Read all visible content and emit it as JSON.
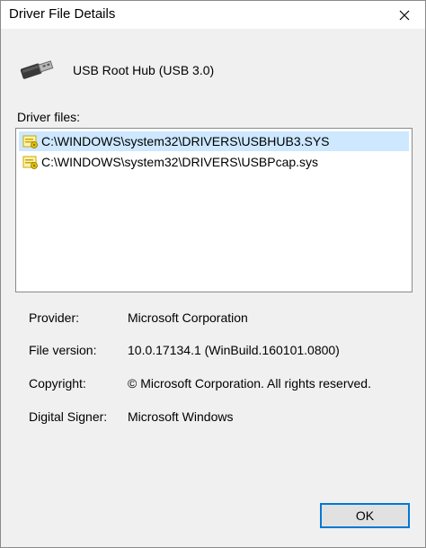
{
  "window": {
    "title": "Driver File Details",
    "close_icon": "close-icon"
  },
  "device": {
    "icon": "usb-plug-icon",
    "name": "USB Root Hub (USB 3.0)"
  },
  "driver_files": {
    "label": "Driver files:",
    "items": [
      {
        "path": "C:\\WINDOWS\\system32\\DRIVERS\\USBHUB3.SYS",
        "selected": true
      },
      {
        "path": "C:\\WINDOWS\\system32\\DRIVERS\\USBPcap.sys",
        "selected": false
      }
    ]
  },
  "details": {
    "provider_label": "Provider:",
    "provider_value": "Microsoft Corporation",
    "version_label": "File version:",
    "version_value": "10.0.17134.1 (WinBuild.160101.0800)",
    "copyright_label": "Copyright:",
    "copyright_value": "© Microsoft Corporation. All rights reserved.",
    "signer_label": "Digital Signer:",
    "signer_value": "Microsoft Windows"
  },
  "buttons": {
    "ok_label": "OK"
  },
  "colors": {
    "selection": "#cde8ff",
    "focus_border": "#0078d7"
  }
}
